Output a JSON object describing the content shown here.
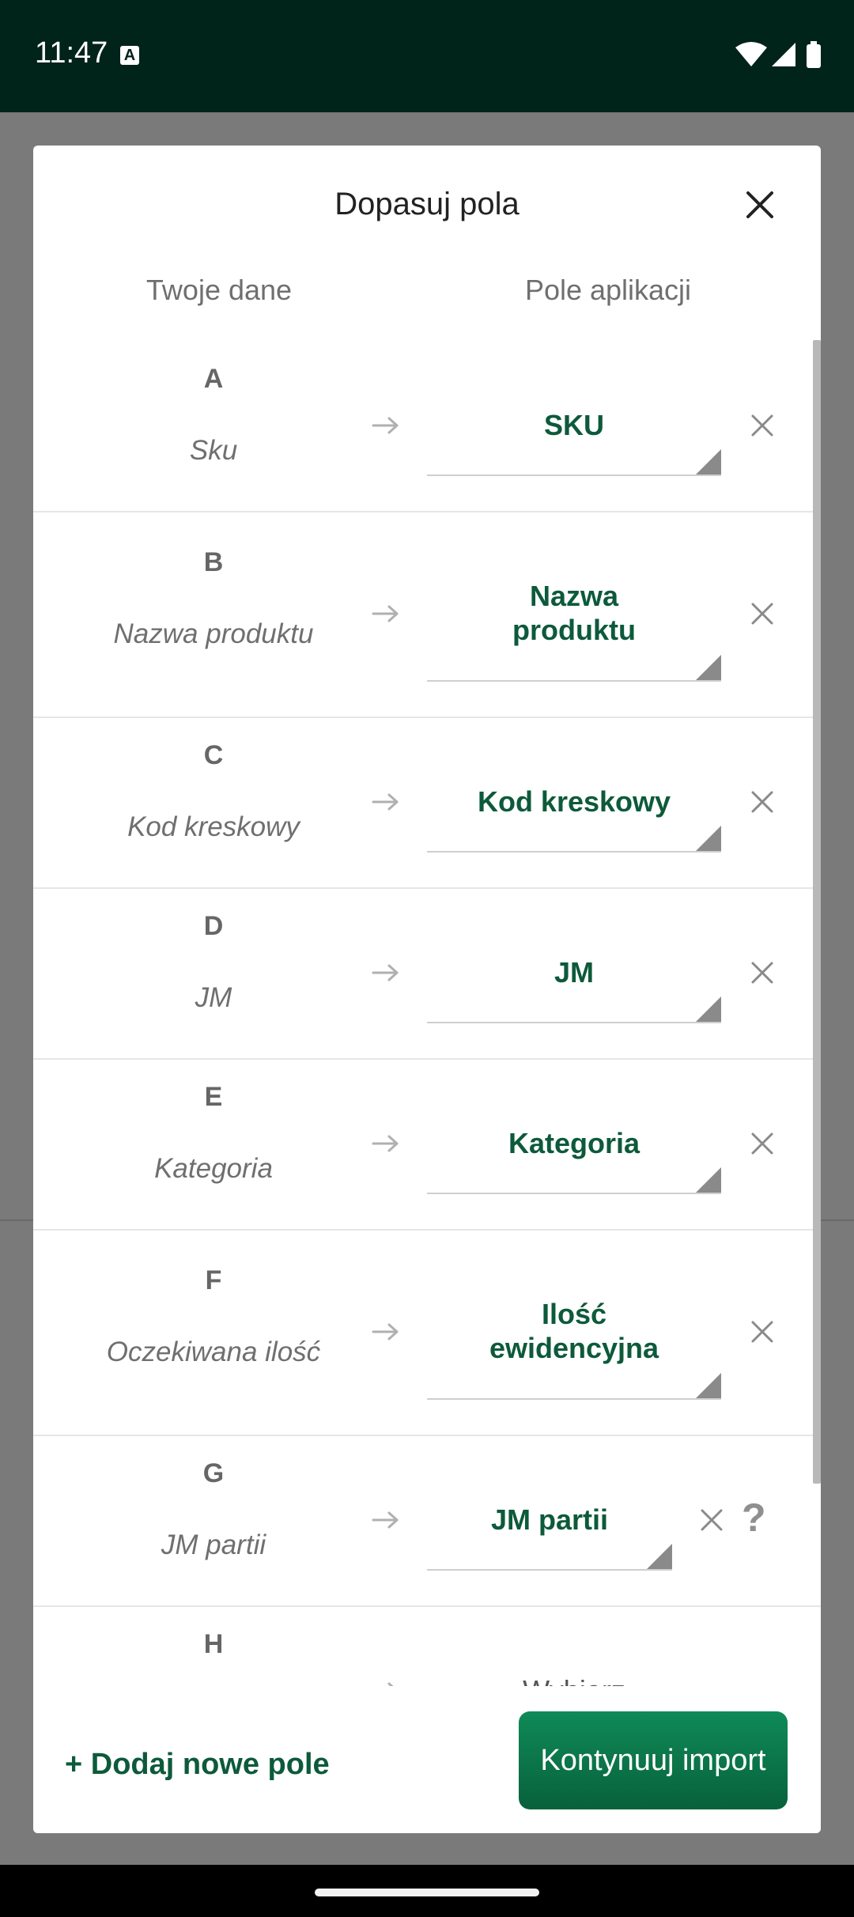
{
  "status": {
    "time": "11:47",
    "icon": "a-notification-icon"
  },
  "dialog": {
    "title": "Dopasuj pola",
    "col_left": "Twoje dane",
    "col_right": "Pole aplikacji"
  },
  "rows": [
    {
      "letter": "A",
      "name": "Sku",
      "field_line1": "SKU",
      "field_line2": ""
    },
    {
      "letter": "B",
      "name": "Nazwa produktu",
      "field_line1": "Nazwa",
      "field_line2": "produktu"
    },
    {
      "letter": "C",
      "name": "Kod kreskowy",
      "field_line1": "Kod kreskowy",
      "field_line2": ""
    },
    {
      "letter": "D",
      "name": "JM",
      "field_line1": "JM",
      "field_line2": ""
    },
    {
      "letter": "E",
      "name": "Kategoria",
      "field_line1": "Kategoria",
      "field_line2": ""
    },
    {
      "letter": "F",
      "name": "Oczekiwana ilość",
      "field_line1": "Ilość",
      "field_line2": "ewidencyjna"
    },
    {
      "letter": "G",
      "name": "JM partii",
      "field_line1": "JM partii",
      "field_line2": ""
    },
    {
      "letter": "H",
      "name": "",
      "field_line1": "Wybierz",
      "field_line2": ""
    }
  ],
  "help_label": "?",
  "bottom": {
    "add_field": "+ Dodaj nowe pole",
    "continue": "Kontynuuj import"
  },
  "colors": {
    "accent": "#0d5a3a",
    "button": "#0a7148",
    "statusbar": "#00231a"
  }
}
